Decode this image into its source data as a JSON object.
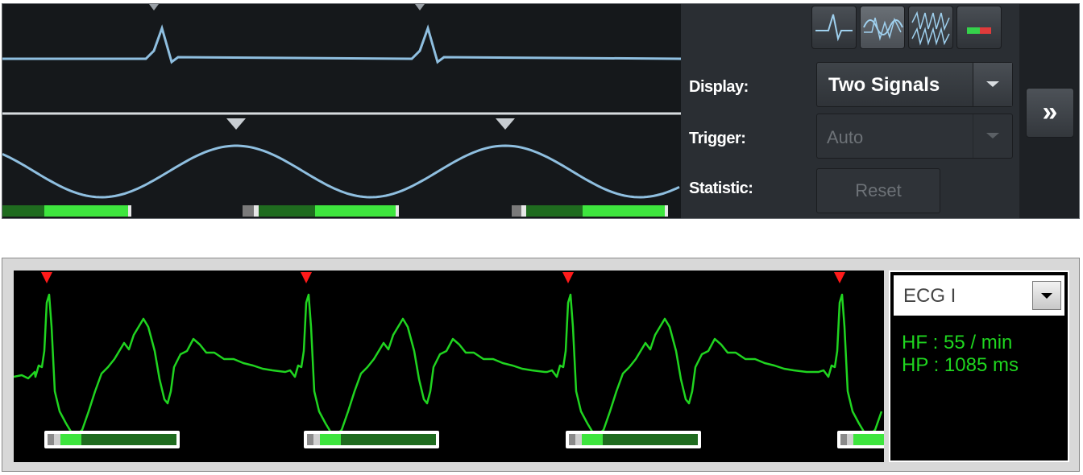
{
  "top_panel": {
    "display_label": "Display:",
    "display_value": "Two Signals",
    "trigger_label": "Trigger:",
    "trigger_value": "Auto",
    "statistic_label": "Statistic:",
    "reset_label": "Reset",
    "expand_label": "»",
    "mode_buttons": [
      "single-signal-icon",
      "overlay-signals-icon",
      "multi-signal-icon",
      "status-indicator-icon"
    ],
    "colors": {
      "trace": "#8fbfe0",
      "bar_dark": "#1f6b1f",
      "bar_light": "#3ee53e",
      "background": "#15181b"
    }
  },
  "bottom_panel": {
    "lead_select_value": "ECG I",
    "heart_rate": "HF : 55 / min",
    "heart_period": "HP : 1085 ms",
    "colors": {
      "trace": "#20d420",
      "marker": "#ff1a1a",
      "background": "#000000"
    }
  }
}
